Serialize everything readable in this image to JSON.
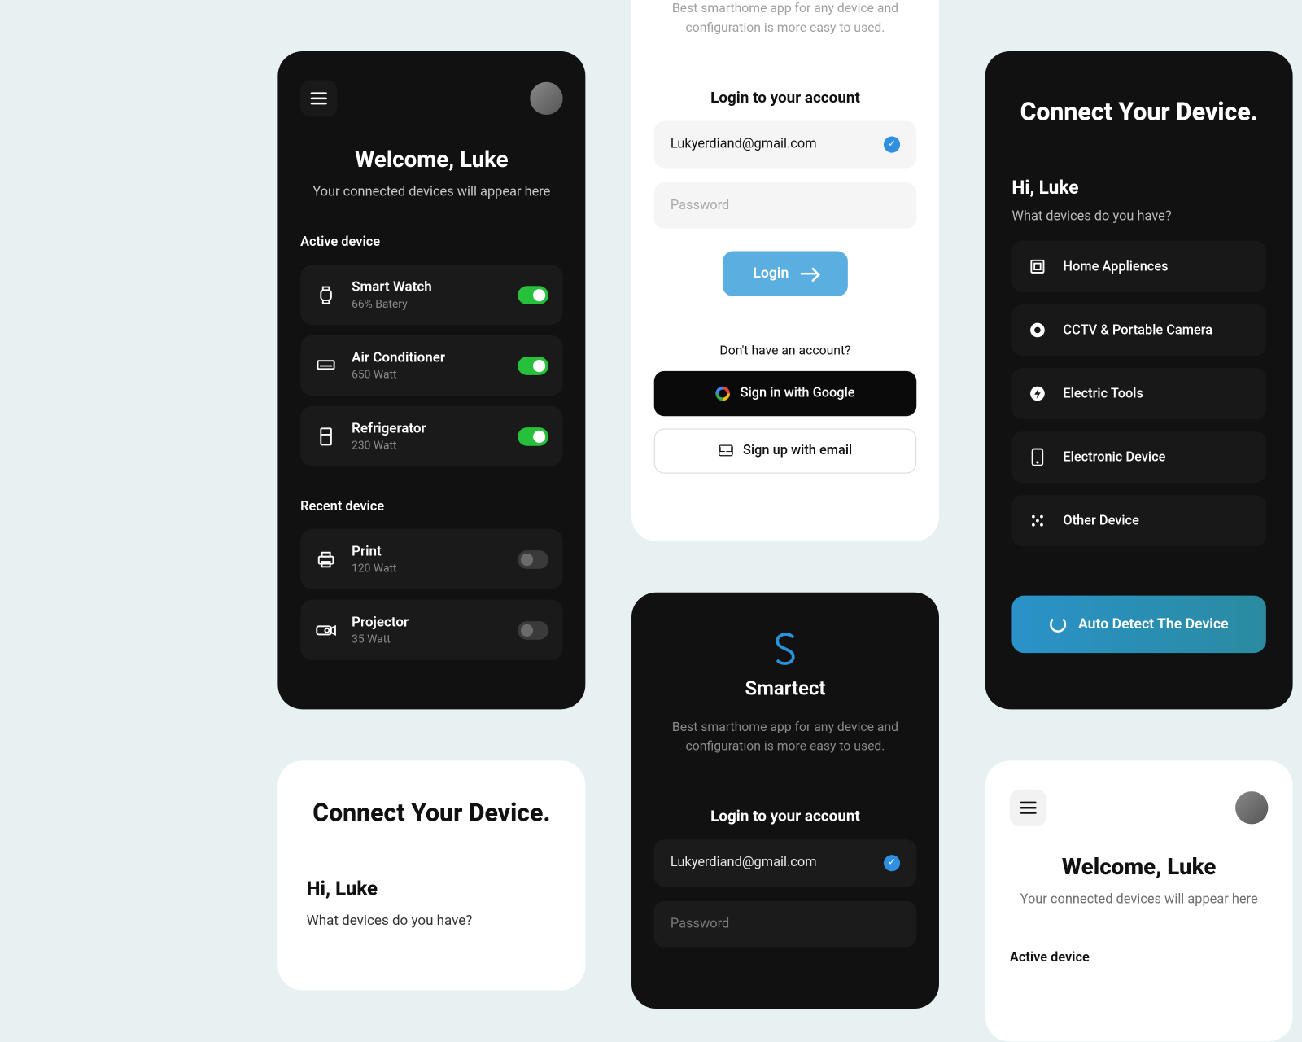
{
  "dashboard": {
    "welcome_title": "Welcome, Luke",
    "welcome_sub": "Your connected devices will appear here",
    "active_label": "Active device",
    "recent_label": "Recent device",
    "devices_active": [
      {
        "name": "Smart Watch",
        "meta": "66% Batery",
        "on": true
      },
      {
        "name": "Air Conditioner",
        "meta": "650 Watt",
        "on": true
      },
      {
        "name": "Refrigerator",
        "meta": "230 Watt",
        "on": true
      }
    ],
    "devices_recent": [
      {
        "name": "Print",
        "meta": "120 Watt",
        "on": false
      },
      {
        "name": "Projector",
        "meta": "35 Watt",
        "on": false
      }
    ]
  },
  "login": {
    "tagline": "Best smarthome app for any device and configuration is more easy to used.",
    "heading": "Login to your account",
    "email_value": "Lukyerdiand@gmail.com",
    "password_placeholder": "Password",
    "login_label": "Login",
    "no_account": "Don't have an account?",
    "google_label": "Sign in with Google",
    "email_label": "Sign up with email",
    "brand": "Smartect"
  },
  "connect": {
    "title": "Connect Your Device.",
    "hi": "Hi, Luke",
    "question": "What devices do you have?",
    "categories": [
      "Home Appliences",
      "CCTV & Portable Camera",
      "Electric Tools",
      "Electronic Device",
      "Other Device"
    ],
    "detect_label": "Auto Detect The Device"
  },
  "colors": {
    "accent_blue": "#5aaee0",
    "toggle_green": "#27c03a",
    "gradient_teal": "#2a8ba0"
  }
}
